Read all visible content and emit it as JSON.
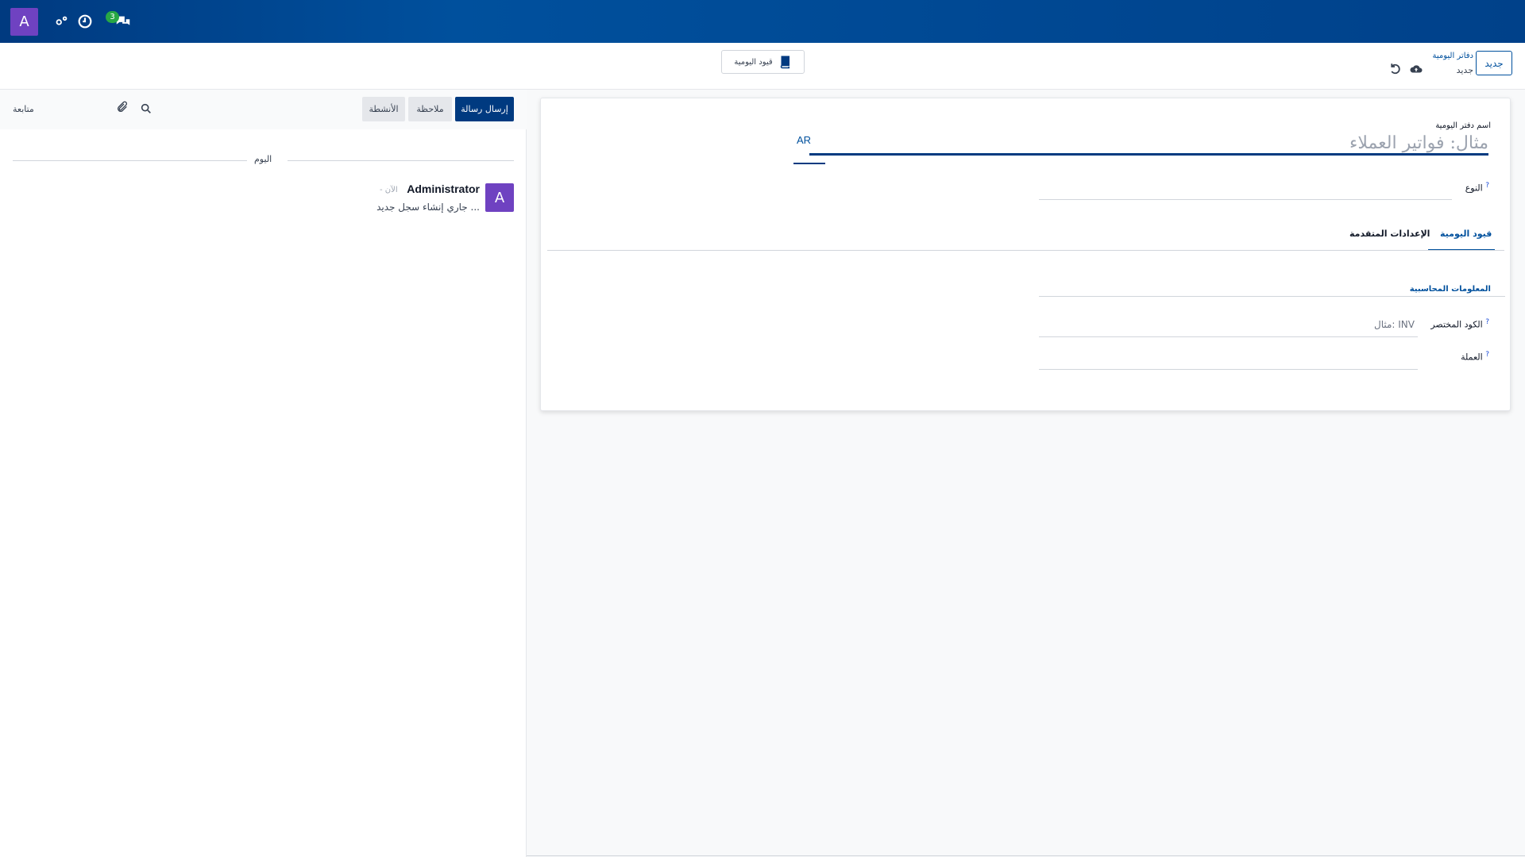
{
  "navbar": {
    "avatar_letter": "A",
    "badge_count": "3"
  },
  "control": {
    "new_button": "جديد",
    "breadcrumb_parent": "دفاتر اليومية",
    "breadcrumb_current": "جديد",
    "smart_button": "قيود اليومية"
  },
  "form": {
    "name_label": "اسم دفتر اليومية",
    "name_placeholder": "مثال: فواتير العملاء",
    "lang": "AR",
    "type_label": "النوع",
    "help_mark": "?",
    "tabs": [
      {
        "label": "قيود اليومية",
        "active": true
      },
      {
        "label": "الإعدادات المتقدمة",
        "active": false
      }
    ],
    "section_title": "المعلومات المحاسبية",
    "code_label": "الكود المختصر",
    "code_placeholder": "مثال: INV",
    "currency_label": "العملة"
  },
  "chatter": {
    "send_message": "إرسال رسالة",
    "log_note": "ملاحظة",
    "activities": "الأنشطة",
    "follow": "متابعة",
    "today": "اليوم",
    "message": {
      "avatar_letter": "A",
      "author": "Administrator",
      "time": "- الآن",
      "body": "جاري إنشاء سجل جديد ..."
    }
  },
  "colors": {
    "navbar": "#00509d",
    "primary": "#003a80",
    "avatar": "#6f42c1",
    "badge": "#28a745"
  }
}
